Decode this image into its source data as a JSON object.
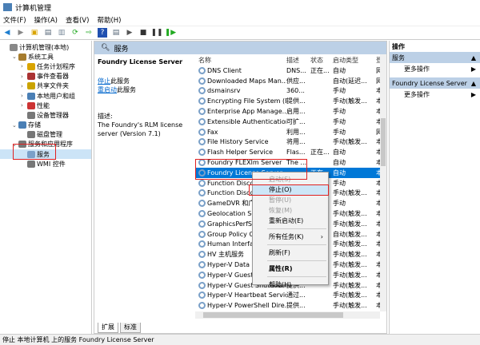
{
  "window": {
    "title": "计算机管理"
  },
  "menu": [
    "文件(F)",
    "操作(A)",
    "查看(V)",
    "帮助(H)"
  ],
  "tree": [
    {
      "label": "计算机管理(本地)",
      "level": 0,
      "arrow": ""
    },
    {
      "label": "系统工具",
      "level": 1,
      "arrow": "v"
    },
    {
      "label": "任务计划程序",
      "level": 2,
      "arrow": ">"
    },
    {
      "label": "事件查看器",
      "level": 2,
      "arrow": ">"
    },
    {
      "label": "共享文件夹",
      "level": 2,
      "arrow": ">"
    },
    {
      "label": "本地用户和组",
      "level": 2,
      "arrow": ">"
    },
    {
      "label": "性能",
      "level": 2,
      "arrow": ">"
    },
    {
      "label": "设备管理器",
      "level": 2,
      "arrow": ""
    },
    {
      "label": "存储",
      "level": 1,
      "arrow": "v"
    },
    {
      "label": "磁盘管理",
      "level": 2,
      "arrow": ""
    },
    {
      "label": "服务和应用程序",
      "level": 1,
      "arrow": "v"
    },
    {
      "label": "服务",
      "level": 2,
      "arrow": ""
    },
    {
      "label": "WMI 控件",
      "level": 2,
      "arrow": ""
    }
  ],
  "main": {
    "header": "服务",
    "service_name": "Foundry License Server",
    "stop_link": "停止",
    "stop_suffix": "此服务",
    "restart_link": "重启动",
    "restart_suffix": "此服务",
    "desc_label": "描述:",
    "desc_text": "The Foundry's RLM license server (Version 7.1)",
    "columns": [
      "名称",
      "描述",
      "状态",
      "启动类型",
      "登"
    ],
    "rows": [
      [
        "DNS Client",
        "DNS...",
        "正在...",
        "自动",
        "网"
      ],
      [
        "Downloaded Maps Man...",
        "供应...",
        "",
        "自动(延迟...",
        "网"
      ],
      [
        "dsmainsrv",
        "360...",
        "",
        "手动",
        "本"
      ],
      [
        "Encrypting File System (E...",
        "提供...",
        "",
        "手动(触发...",
        "本"
      ],
      [
        "Enterprise App Manage...",
        "启用...",
        "",
        "手动",
        "本"
      ],
      [
        "Extensible Authentication...",
        "可扩...",
        "",
        "手动",
        "本"
      ],
      [
        "Fax",
        "利用...",
        "",
        "手动",
        "网"
      ],
      [
        "File History Service",
        "将用...",
        "",
        "手动(触发...",
        "本"
      ],
      [
        "Flash Helper Service",
        "Flas...",
        "正在...",
        "自动",
        "本"
      ],
      [
        "Foundry FLEXlm Server",
        "The ...",
        "",
        "自动",
        "本"
      ],
      [
        "Foundry License Server",
        "",
        "正在...",
        "自动",
        "本"
      ],
      [
        "Function Discovery Provi...",
        "",
        "",
        "手动",
        "本"
      ],
      [
        "Function Discovery Reso...",
        "",
        "",
        "手动(触发...",
        "本"
      ],
      [
        "GameDVR 和广播用户服务",
        "",
        "",
        "手动",
        "本"
      ],
      [
        "Geolocation Service",
        "",
        "",
        "手动(触发...",
        "本"
      ],
      [
        "GraphicsPerfSvc",
        "",
        "",
        "手动(触发...",
        "本"
      ],
      [
        "Group Policy Client",
        "",
        "",
        "自动(触发...",
        "本"
      ],
      [
        "Human Interface Device...",
        "",
        "",
        "手动(触发...",
        "本"
      ],
      [
        "HV 主机服务",
        "",
        "",
        "手动(触发...",
        "本"
      ],
      [
        "Hyper-V Data Exchange...",
        "",
        "",
        "手动(触发...",
        "本"
      ],
      [
        "Hyper-V Guest Service...",
        "",
        "",
        "手动(触发...",
        "本"
      ],
      [
        "Hyper-V Guest Shutdown...",
        "提供...",
        "",
        "手动(触发...",
        "本"
      ],
      [
        "Hyper-V Heartbeat Service",
        "通过...",
        "",
        "手动(触发...",
        "本"
      ],
      [
        "Hyper-V PowerShell Dire...",
        "提供...",
        "",
        "手动(触发...",
        "本"
      ]
    ],
    "selected_index": 10,
    "tabs": [
      "扩展",
      "标准"
    ]
  },
  "context_menu": [
    {
      "label": "启动(S)",
      "disabled": true
    },
    {
      "label": "停止(O)",
      "highlight": true
    },
    {
      "label": "暂停(U)",
      "disabled": true
    },
    {
      "label": "恢复(M)",
      "disabled": true
    },
    {
      "label": "重新启动(E)"
    },
    {
      "sep": true
    },
    {
      "label": "所有任务(K)",
      "submenu": true
    },
    {
      "sep": true
    },
    {
      "label": "刷新(F)"
    },
    {
      "sep": true
    },
    {
      "label": "属性(R)",
      "bold": true
    },
    {
      "sep": true
    },
    {
      "label": "帮助(H)"
    }
  ],
  "actions": {
    "title": "操作",
    "sections": [
      {
        "title": "服务",
        "item": "更多操作"
      },
      {
        "title": "Foundry License Server",
        "item": "更多操作"
      }
    ]
  },
  "status_bar": "停止 本地计算机 上的服务 Foundry License Server",
  "colors": {
    "selection": "#0078d7",
    "header": "#bcd0e6",
    "highlight_box": "#e02020"
  }
}
